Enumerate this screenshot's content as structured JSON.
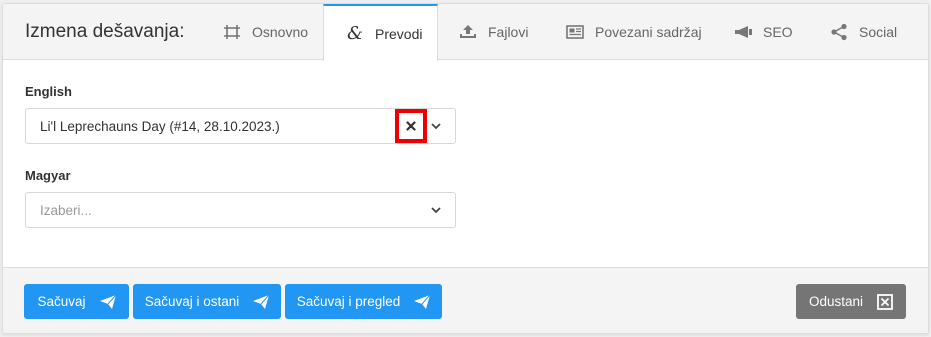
{
  "header": {
    "title": "Izmena dešavanja:"
  },
  "tabs": [
    {
      "label": "Osnovno",
      "icon": "frame-icon"
    },
    {
      "label": "Prevodi",
      "icon": "ampersand-icon"
    },
    {
      "label": "Fajlovi",
      "icon": "upload-icon"
    },
    {
      "label": "Povezani sadržaj",
      "icon": "newspaper-icon"
    },
    {
      "label": "SEO",
      "icon": "megaphone-icon"
    },
    {
      "label": "Social",
      "icon": "share-icon"
    }
  ],
  "fields": {
    "english": {
      "label": "English",
      "value": "Li'l Leprechauns Day (#14, 28.10.2023.)"
    },
    "magyar": {
      "label": "Magyar",
      "placeholder": "Izaberi..."
    }
  },
  "footer": {
    "save": "Sačuvaj",
    "save_stay": "Sačuvaj i ostani",
    "save_view": "Sačuvaj i pregled",
    "cancel": "Odustani"
  },
  "colors": {
    "accent": "#2196f3",
    "highlight": "#ee0000",
    "cancel": "#757575"
  }
}
